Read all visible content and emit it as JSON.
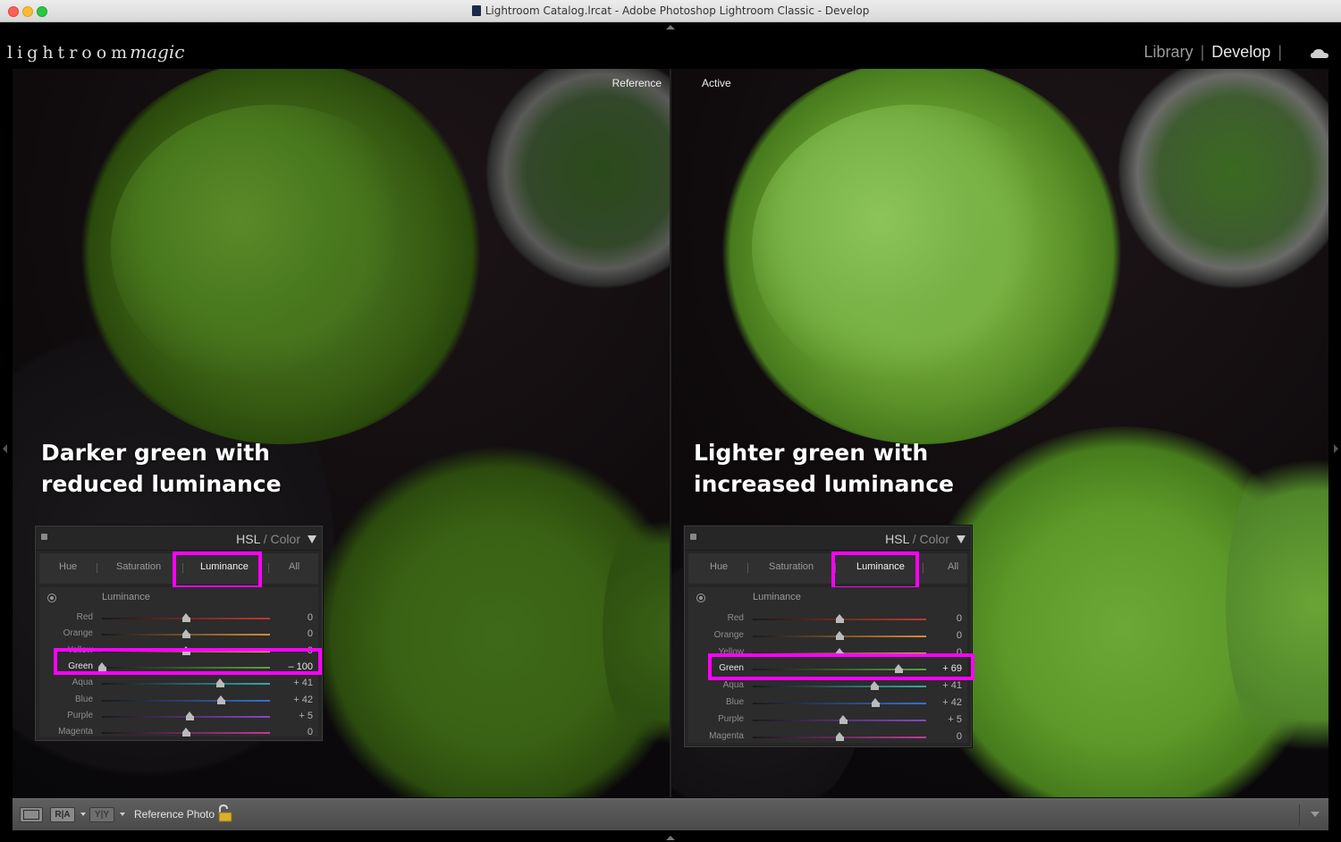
{
  "window": {
    "title": "Lightroom Catalog.lrcat - Adobe Photoshop Lightroom Classic - Develop"
  },
  "brand": {
    "text": "lightroom",
    "script": "magic"
  },
  "modules": {
    "library": "Library",
    "develop": "Develop",
    "active": "develop"
  },
  "panes": {
    "left": {
      "label": "Reference",
      "caption_line1": "Darker green with",
      "caption_line2": "reduced luminance"
    },
    "right": {
      "label": "Active",
      "caption_line1": "Lighter green with",
      "caption_line2": "increased luminance"
    }
  },
  "hsl_panels": [
    {
      "title_a": "HSL",
      "title_sep": " / ",
      "title_b": "Color",
      "tabs": [
        "Hue",
        "Saturation",
        "Luminance",
        "All"
      ],
      "active_tab": "Luminance",
      "section": "Luminance",
      "sliders": [
        {
          "name": "Red",
          "value": 0,
          "display": "0"
        },
        {
          "name": "Orange",
          "value": 0,
          "display": "0"
        },
        {
          "name": "Yellow",
          "value": 0,
          "display": "0"
        },
        {
          "name": "Green",
          "value": -100,
          "display": "– 100",
          "highlight": true
        },
        {
          "name": "Aqua",
          "value": 41,
          "display": "+ 41"
        },
        {
          "name": "Blue",
          "value": 42,
          "display": "+ 42"
        },
        {
          "name": "Purple",
          "value": 5,
          "display": "+ 5"
        },
        {
          "name": "Magenta",
          "value": 0,
          "display": "0"
        }
      ]
    },
    {
      "title_a": "HSL",
      "title_sep": " / ",
      "title_b": "Color",
      "tabs": [
        "Hue",
        "Saturation",
        "Luminance",
        "All"
      ],
      "active_tab": "Luminance",
      "section": "Luminance",
      "sliders": [
        {
          "name": "Red",
          "value": 0,
          "display": "0"
        },
        {
          "name": "Orange",
          "value": 0,
          "display": "0"
        },
        {
          "name": "Yellow",
          "value": 0,
          "display": "0"
        },
        {
          "name": "Green",
          "value": 69,
          "display": "+ 69",
          "highlight": true
        },
        {
          "name": "Aqua",
          "value": 41,
          "display": "+ 41"
        },
        {
          "name": "Blue",
          "value": 42,
          "display": "+ 42"
        },
        {
          "name": "Purple",
          "value": 5,
          "display": "+ 5"
        },
        {
          "name": "Magenta",
          "value": 0,
          "display": "0"
        }
      ]
    }
  ],
  "slider_colors": {
    "Red": "#c0392b",
    "Orange": "#d68a3a",
    "Yellow": "#cfc03a",
    "Green": "#5aa33a",
    "Aqua": "#3aa6a6",
    "Blue": "#3a6fc9",
    "Purple": "#8a46c4",
    "Magenta": "#c23a9a"
  },
  "highlight_color": "#ff00ff",
  "toolbar": {
    "ref_photo_label": "Reference Photo :",
    "ra_label": "R|A",
    "yy_label": "Y|Y"
  }
}
